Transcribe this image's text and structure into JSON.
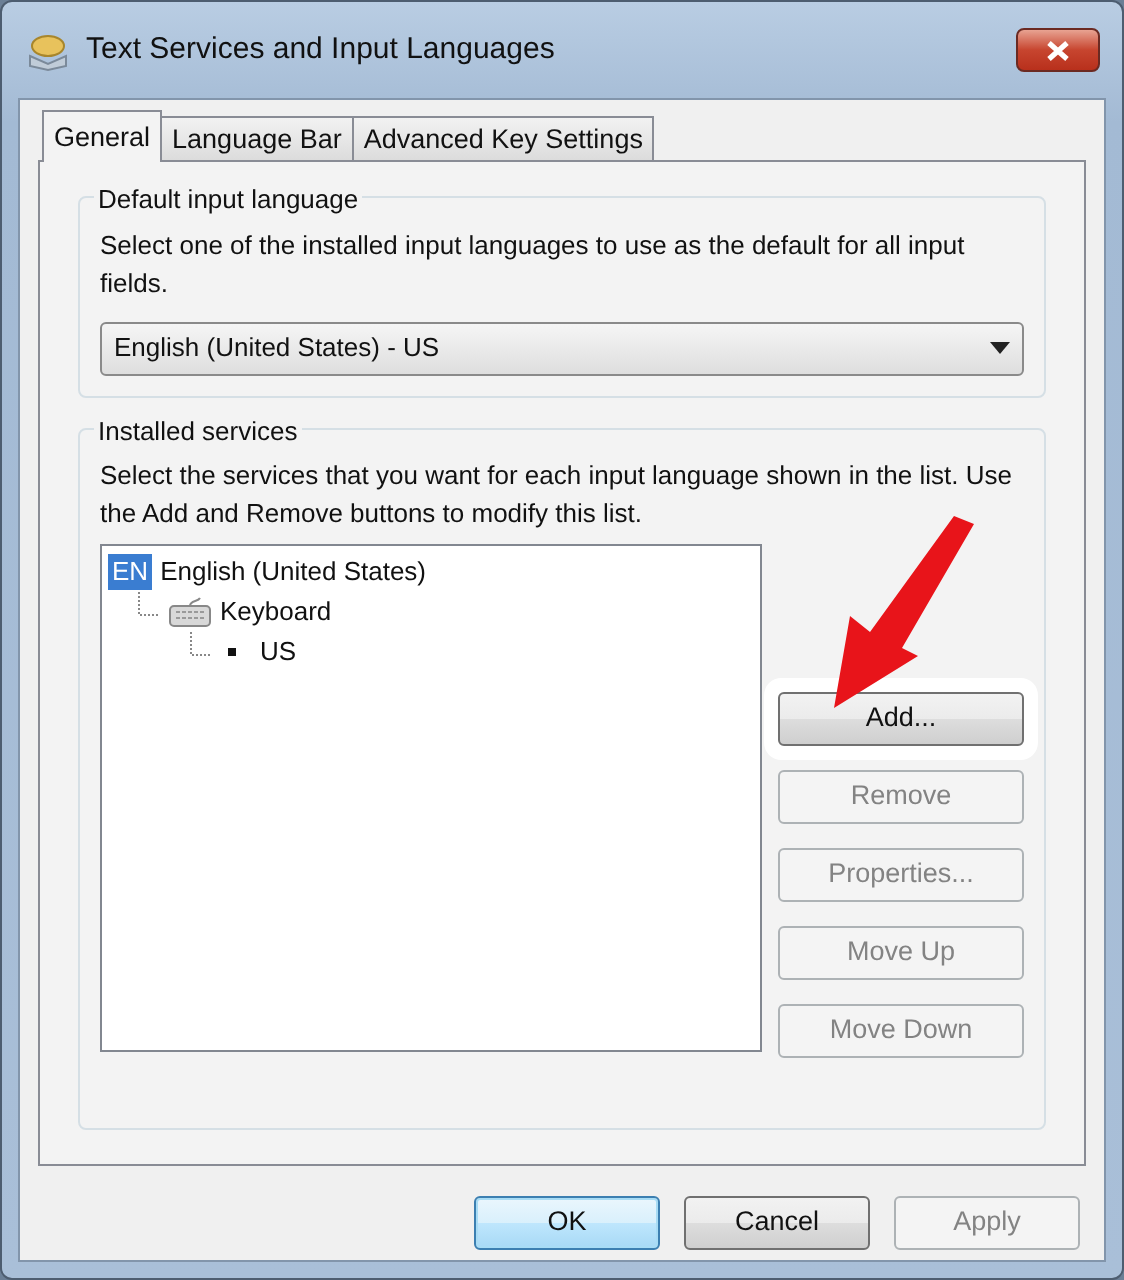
{
  "window": {
    "title": "Text Services and Input Languages"
  },
  "tabs": [
    {
      "label": "General",
      "selected": true
    },
    {
      "label": "Language Bar",
      "selected": false
    },
    {
      "label": "Advanced Key Settings",
      "selected": false
    }
  ],
  "default_language": {
    "title": "Default input language",
    "description": "Select one of the installed input languages to use as the default for all input fields.",
    "dropdown": {
      "value": "English (United States) - US"
    }
  },
  "installed_services": {
    "title": "Installed services",
    "description": "Select the services that you want for each input language shown in the list. Use the Add and Remove buttons to modify this list.",
    "tree": [
      {
        "kind": "language",
        "badge": "EN",
        "label": "English (United States)",
        "children": [
          {
            "kind": "category",
            "label": "Keyboard",
            "children": [
              {
                "kind": "service",
                "label": "US"
              }
            ]
          }
        ]
      }
    ],
    "buttons": [
      {
        "label": "Add...",
        "disabled": false,
        "highlighted": true
      },
      {
        "label": "Remove",
        "disabled": true,
        "highlighted": false
      },
      {
        "label": "Properties...",
        "disabled": true,
        "highlighted": false
      },
      {
        "label": "Move Up",
        "disabled": true,
        "highlighted": false
      },
      {
        "label": "Move Down",
        "disabled": true,
        "highlighted": false
      }
    ]
  },
  "dialog_buttons": [
    {
      "label": "OK",
      "default": true,
      "disabled": false
    },
    {
      "label": "Cancel",
      "default": false,
      "disabled": false
    },
    {
      "label": "Apply",
      "default": false,
      "disabled": true
    }
  ]
}
